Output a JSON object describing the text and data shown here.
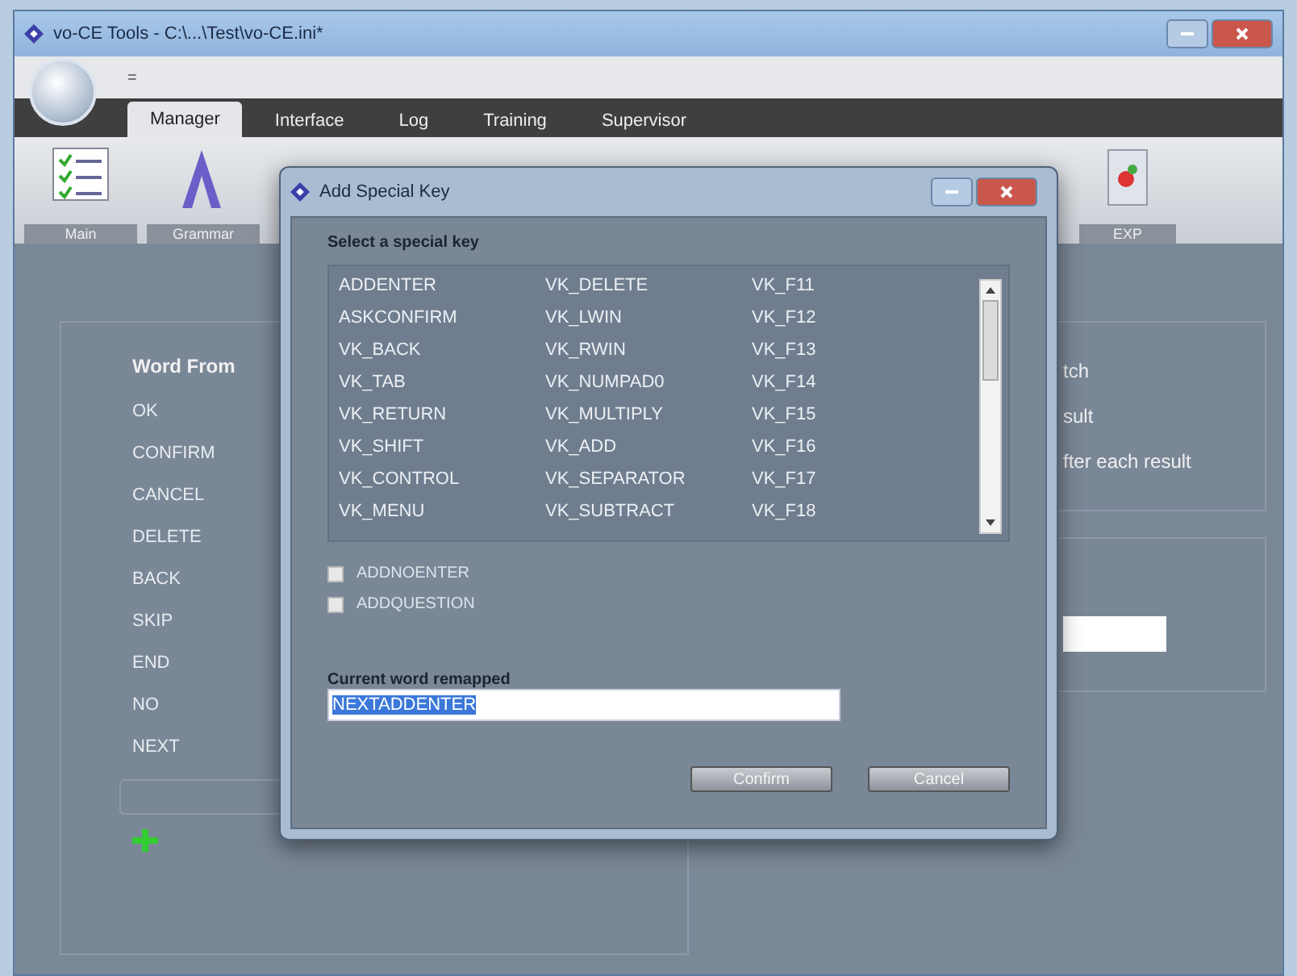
{
  "window": {
    "title": "vo-CE Tools - C:\\...\\Test\\vo-CE.ini*"
  },
  "quick_access": {
    "label": "="
  },
  "tabs": [
    {
      "label": "Manager",
      "selected": true
    },
    {
      "label": "Interface",
      "selected": false
    },
    {
      "label": "Log",
      "selected": false
    },
    {
      "label": "Training",
      "selected": false
    },
    {
      "label": "Supervisor",
      "selected": false
    }
  ],
  "ribbon": {
    "groups": [
      "Main",
      "Grammar",
      "EXP"
    ]
  },
  "word_panel": {
    "heading": "Word From",
    "words": [
      "OK",
      "CONFIRM",
      "CANCEL",
      "DELETE",
      "BACK",
      "SKIP",
      "END",
      "NO",
      "NEXT"
    ]
  },
  "options_panel": {
    "lines": [
      "tch",
      "sult",
      "fter each result"
    ]
  },
  "dialog": {
    "title": "Add Special Key",
    "list_label": "Select a special key",
    "keys": [
      [
        "ADDENTER",
        "VK_DELETE",
        "VK_F11"
      ],
      [
        "ASKCONFIRM",
        "VK_LWIN",
        "VK_F12"
      ],
      [
        "VK_BACK",
        "VK_RWIN",
        "VK_F13"
      ],
      [
        "VK_TAB",
        "VK_NUMPAD0",
        "VK_F14"
      ],
      [
        "VK_RETURN",
        "VK_MULTIPLY",
        "VK_F15"
      ],
      [
        "VK_SHIFT",
        "VK_ADD",
        "VK_F16"
      ],
      [
        "VK_CONTROL",
        "VK_SEPARATOR",
        "VK_F17"
      ],
      [
        "VK_MENU",
        "VK_SUBTRACT",
        "VK_F18"
      ]
    ],
    "checkboxes": [
      {
        "label": "ADDNOENTER",
        "checked": false
      },
      {
        "label": "ADDQUESTION",
        "checked": false
      }
    ],
    "field_label": "Current word remapped",
    "field_value": "NEXTADDENTER",
    "buttons": [
      "Confirm",
      "Cancel"
    ]
  }
}
